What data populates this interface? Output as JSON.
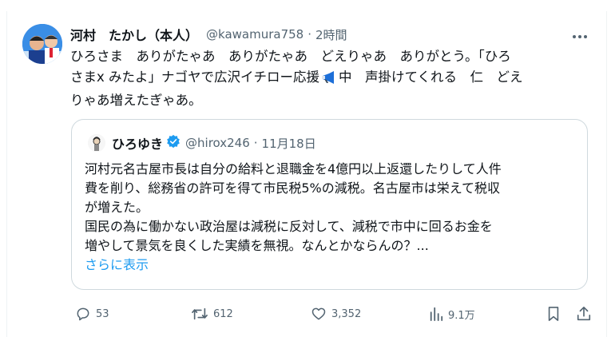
{
  "tweet": {
    "author_name": "河村　たかし（本人）",
    "author_handle": "@kawamura758",
    "separator": "·",
    "time": "2時間",
    "text_lines": [
      "ひろさま　ありがたゃあ　ありがたゃあ　どえりゃあ　ありがとう。「ひろ",
      "さまx みたよ」ナゴヤで広沢イチロー応援",
      "中　声掛けてくれる　仁　どえ",
      "りゃあ増えたぎゃあ。"
    ],
    "icons": {
      "more": "more-icon",
      "megaphone": "megaphone-icon"
    }
  },
  "quote": {
    "author_name": "ひろゆき",
    "author_handle": "@hirox246",
    "separator": "·",
    "date": "11月18日",
    "verified_color": "#1d9bf0",
    "body_lines": [
      "河村元名古屋市長は自分の給料と退職金を4億円以上返還したりして人件",
      "費を削り、総務省の許可を得て市民税5%の減税。名古屋市は栄えて税収",
      "が増えた。",
      "国民の為に働かない政治屋は減税に反対して、減税で市中に回るお金を",
      "増やして景気を良くした実績を無視。なんとかならんの？..."
    ],
    "show_more": "さらに表示"
  },
  "actions": {
    "reply": {
      "icon": "reply-icon",
      "count": "53"
    },
    "repost": {
      "icon": "repost-icon",
      "count": "612"
    },
    "like": {
      "icon": "heart-icon",
      "count": "3,352"
    },
    "views": {
      "icon": "views-icon",
      "count": "9.1万"
    },
    "bookmark": {
      "icon": "bookmark-icon"
    },
    "share": {
      "icon": "share-icon"
    }
  },
  "colors": {
    "text": "#0f1419",
    "secondary": "#536471",
    "link": "#1d9bf0",
    "border": "#cfd9de"
  }
}
